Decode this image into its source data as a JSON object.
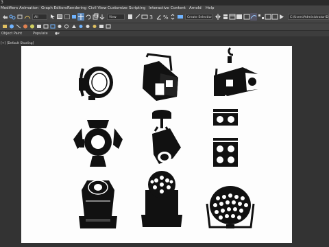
{
  "window": {
    "title": "3"
  },
  "menu": {
    "items": [
      "Modifiers",
      "Animation",
      "Graph Editors",
      "Rendering",
      "Civil View",
      "Customize",
      "Scripting",
      "Interactive",
      "Content",
      "Arnold",
      "Help"
    ]
  },
  "toolbar": {
    "filter_dropdown": "All",
    "view_dropdown": "View",
    "selection_set": "Create Selection Set",
    "path_field": "C:\\Users\\Administrator\\Docum"
  },
  "ribbon": {
    "object_paint": "Object Paint",
    "populate": "Populate"
  },
  "viewport": {
    "label": "[+] [Default Shading]"
  },
  "scene": {
    "objects": [
      "fresnel-light",
      "profile-spot-light",
      "ellipsoidal-spot-light",
      "barn-door-light",
      "pin-spot-light",
      "blinder-2-light",
      "blinder-4-light",
      "moving-head-spot",
      "moving-head-wash",
      "led-par-light"
    ]
  },
  "colors": {
    "bg": "#3a3a3a",
    "menubar": "#444444",
    "viewport": "#fdfdfd",
    "fixture": "#111111"
  }
}
